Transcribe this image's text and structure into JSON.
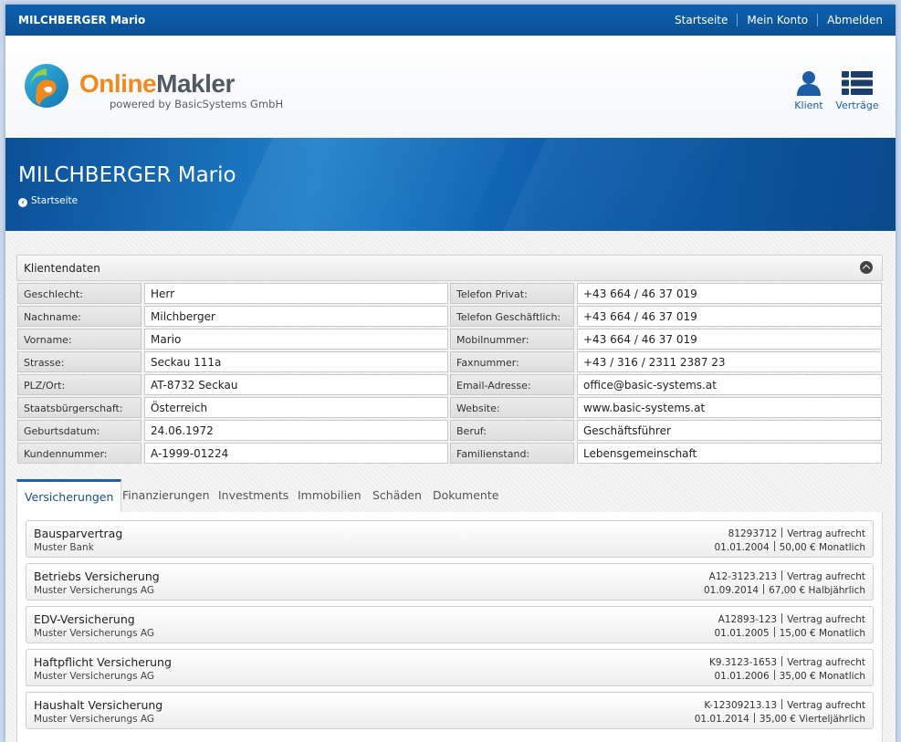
{
  "topbar": {
    "user": "MILCHBERGER Mario",
    "nav": [
      "Startseite",
      "Mein Konto",
      "Abmelden"
    ]
  },
  "logo": {
    "online": "Online",
    "makler": "Makler",
    "tagline": "powered by BasicSystems GmbH",
    "colors": {
      "orange": "#f08a1c",
      "teal": "#1aa0c8",
      "green": "#7cc142"
    }
  },
  "header_icons": {
    "klient": {
      "label": "Klient",
      "icon": "user-icon"
    },
    "vertraege": {
      "label": "Verträge",
      "icon": "list-icon"
    }
  },
  "banner": {
    "title": "MILCHBERGER Mario",
    "breadcrumb": "Startseite"
  },
  "panel": {
    "title": "Klientendaten",
    "left": [
      {
        "label": "Geschlecht:",
        "value": "Herr"
      },
      {
        "label": "Nachname:",
        "value": "Milchberger"
      },
      {
        "label": "Vorname:",
        "value": "Mario"
      },
      {
        "label": "Strasse:",
        "value": "Seckau 111a"
      },
      {
        "label": "PLZ/Ort:",
        "value": "AT-8732 Seckau"
      },
      {
        "label": "Staatsbürgerschaft:",
        "value": "Österreich"
      },
      {
        "label": "Geburtsdatum:",
        "value": "24.06.1972"
      },
      {
        "label": "Kundennummer:",
        "value": "A-1999-01224"
      }
    ],
    "right": [
      {
        "label": "Telefon Privat:",
        "value": "+43 664 / 46 37 019"
      },
      {
        "label": "Telefon Geschäftlich:",
        "value": "+43 664 / 46 37 019"
      },
      {
        "label": "Mobilnummer:",
        "value": "+43 664 / 46 37 019"
      },
      {
        "label": "Faxnummer:",
        "value": "+43 / 316 / 2311 2387 23"
      },
      {
        "label": "Email-Adresse:",
        "value": "office@basic-systems.at"
      },
      {
        "label": "Website:",
        "value": "www.basic-systems.at"
      },
      {
        "label": "Beruf:",
        "value": "Geschäftsführer"
      },
      {
        "label": "Familienstand:",
        "value": "Lebensgemeinschaft"
      }
    ]
  },
  "tabs": [
    "Versicherungen",
    "Finanzierungen",
    "Investments",
    "Immobilien",
    "Schäden",
    "Dokumente"
  ],
  "contracts": [
    {
      "name": "Bausparvertrag",
      "company": "Muster Bank",
      "number": "81293712",
      "status": "Vertrag aufrecht",
      "date": "01.01.2004",
      "amount": "50,00 € Monatlich"
    },
    {
      "name": "Betriebs Versicherung",
      "company": "Muster Versicherungs AG",
      "number": "A12-3123.213",
      "status": "Vertrag aufrecht",
      "date": "01.09.2014",
      "amount": "67,00 € Halbjährlich"
    },
    {
      "name": "EDV-Versicherung",
      "company": "Muster Versicherungs AG",
      "number": "A12893-123",
      "status": "Vertrag aufrecht",
      "date": "01.01.2005",
      "amount": "15,00 € Monatlich"
    },
    {
      "name": "Haftpflicht Versicherung",
      "company": "Muster Versicherungs AG",
      "number": "K9.3123-1653",
      "status": "Vertrag aufrecht",
      "date": "01.01.2006",
      "amount": "35,00 € Monatlich"
    },
    {
      "name": "Haushalt Versicherung",
      "company": "Muster Versicherungs AG",
      "number": "K-12309213.13",
      "status": "Vertrag aufrecht",
      "date": "01.01.2014",
      "amount": "35,00 € Vierteljährlich"
    }
  ]
}
